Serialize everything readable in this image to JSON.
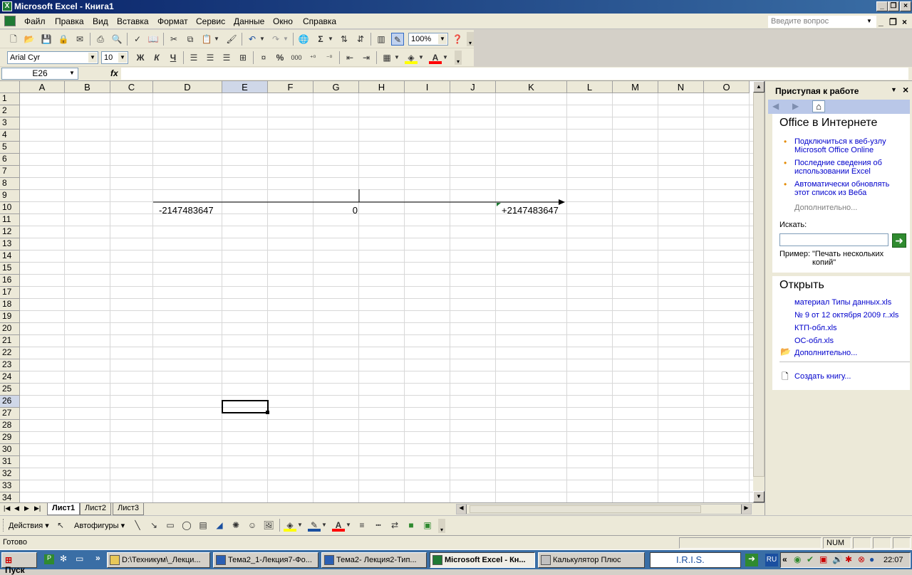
{
  "window": {
    "title": "Microsoft Excel - Книга1",
    "controls": [
      "_",
      "❐",
      "×"
    ]
  },
  "menu": {
    "items": [
      "Файл",
      "Правка",
      "Вид",
      "Вставка",
      "Формат",
      "Сервис",
      "Данные",
      "Окно",
      "Справка"
    ],
    "help_placeholder": "Введите вопрос"
  },
  "toolbar": {
    "zoom": "100%",
    "font_name": "Arial Cyr",
    "font_size": "10",
    "bold": "Ж",
    "italic": "К",
    "underline": "Ч",
    "percent": "%",
    "thousands": "000",
    "sigma": "Σ"
  },
  "formula_bar": {
    "name_box": "E26",
    "fx": "fx",
    "formula": ""
  },
  "grid": {
    "columns": [
      "A",
      "B",
      "C",
      "D",
      "E",
      "F",
      "G",
      "H",
      "I",
      "J",
      "K",
      "L",
      "M",
      "N",
      "O"
    ],
    "rows": [
      "1",
      "2",
      "3",
      "4",
      "5",
      "6",
      "7",
      "8",
      "9",
      "10",
      "11",
      "12",
      "13",
      "14",
      "15",
      "16",
      "17",
      "18",
      "19",
      "20",
      "21",
      "22",
      "23",
      "24",
      "25",
      "26",
      "27",
      "28",
      "29",
      "30",
      "31",
      "32",
      "33",
      "34"
    ],
    "selected_col": "E",
    "selected_row": "26",
    "cells": {
      "D10": "-2147483647",
      "G10": "0",
      "K10": "+2147483647"
    }
  },
  "sheets": {
    "tabs": [
      "Лист1",
      "Лист2",
      "Лист3"
    ],
    "active": "Лист1"
  },
  "task_pane": {
    "title": "Приступая к работе",
    "office_online": {
      "heading": "Office в Интернете",
      "links": [
        "Подключиться к веб-узлу Microsoft Office Online",
        "Последние сведения об использовании Excel",
        "Автоматически обновлять этот список из Веба"
      ],
      "more": "Дополнительно..."
    },
    "search": {
      "label": "Искать:",
      "value": "",
      "example_label": "Пример:",
      "example_text": "\"Печать нескольких копий\""
    },
    "open": {
      "heading": "Открыть",
      "files": [
        "материал Типы данных.xls",
        "№ 9 от 12 октября 2009 г..xls",
        "КТП-обл.xls",
        "ОС-обл.xls"
      ],
      "more": "Дополнительно...",
      "create": "Создать книгу..."
    }
  },
  "drawing_toolbar": {
    "actions": "Действия",
    "autoshapes": "Автофигуры"
  },
  "status": {
    "ready": "Готово",
    "num": "NUM"
  },
  "taskbar": {
    "start": "Пуск",
    "buttons": [
      "D:\\Техникум\\_Лекци...",
      "Тема2_1-Лекция7-Фо...",
      "Тема2- Лекция2-Тип...",
      "Microsoft Excel - Кн...",
      "Калькулятор Плюс"
    ],
    "active_index": 3,
    "iris": "I.R.I.S.",
    "lang": "RU",
    "clock": "22:07"
  }
}
